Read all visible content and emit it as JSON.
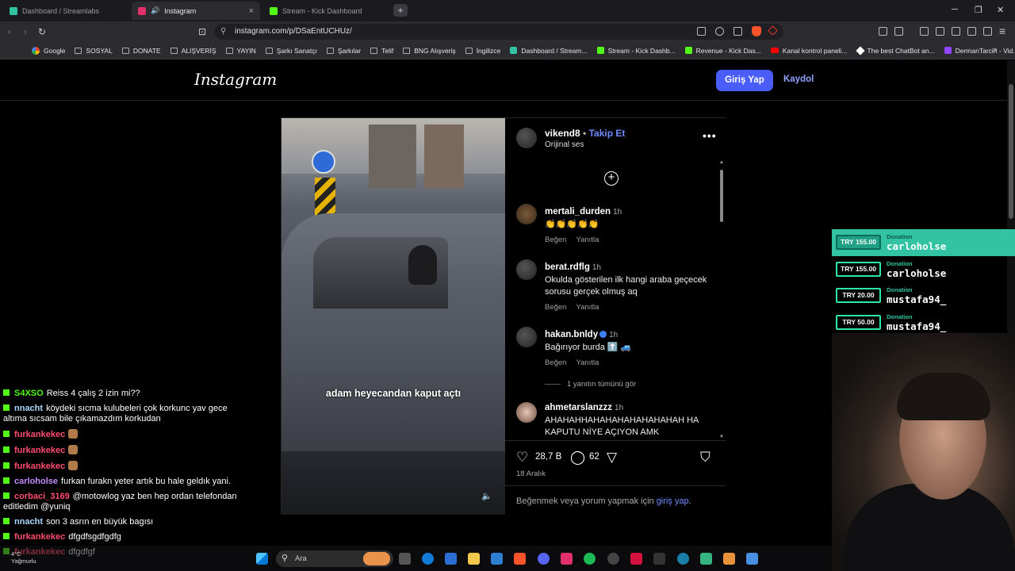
{
  "browser": {
    "tabs": [
      {
        "title": "Dashboard / Streamlabs",
        "color": "#31c3a2"
      },
      {
        "title": "Instagram",
        "color": "#e1306c"
      },
      {
        "title": "Stream - Kick Dashboard",
        "color": "#53fc18"
      }
    ],
    "url": "instagram.com/p/DSaEntUCHUz/",
    "bookmarks": [
      {
        "label": "Google",
        "icon": "google-icon"
      },
      {
        "label": "SOSYAL",
        "icon": "folder-icon"
      },
      {
        "label": "DONATE",
        "icon": "folder-icon"
      },
      {
        "label": "ALIŞVERİŞ",
        "icon": "folder-icon"
      },
      {
        "label": "YAYIN",
        "icon": "folder-icon"
      },
      {
        "label": "Şarkı Sanatçı",
        "icon": "folder-icon"
      },
      {
        "label": "Şarkılar",
        "icon": "folder-icon"
      },
      {
        "label": "Telif",
        "icon": "folder-icon"
      },
      {
        "label": "BNG Alışveriş",
        "icon": "folder-icon"
      },
      {
        "label": "İngilizce",
        "icon": "folder-icon"
      },
      {
        "label": "Dashboard / Stream...",
        "icon": "streamlabs-icon"
      },
      {
        "label": "Stream - Kick Dashb...",
        "icon": "kick-icon"
      },
      {
        "label": "Revenue - Kick Das...",
        "icon": "kick-icon"
      },
      {
        "label": "Kanal kontrol paneli...",
        "icon": "youtube-icon"
      },
      {
        "label": "The best ChatBot an...",
        "icon": "chatbot-icon"
      },
      {
        "label": "DermanTarcin - Vid...",
        "icon": "twitch-icon"
      }
    ]
  },
  "instagram": {
    "logo": "Instagram",
    "login_label": "Giriş Yap",
    "signup_label": "Kaydol",
    "post": {
      "author": "vikend8",
      "follow_label": "Takip Et",
      "audio": "Orijinal ses",
      "video_caption": "adam heyecandan kaput açtı",
      "comments": [
        {
          "user": "mertali_durden",
          "time": "1h",
          "text": "👏👏👏👏👏",
          "like": "Beğen",
          "reply": "Yanıtla"
        },
        {
          "user": "berat.rdflg",
          "time": "1h",
          "text": "Okulda gösterilen ilk hangi araba geçecek sorusu gerçek olmuş aq",
          "like": "Beğen",
          "reply": "Yanıtla"
        },
        {
          "user": "hakan.bnldy",
          "time": "1h",
          "text": "Bağırıyor burda ⬆️ 🚙",
          "like": "Beğen",
          "reply": "Yanıtla"
        },
        {
          "user": "ahmetarslanzzz",
          "time": "1h",
          "text": "AHAHAHHAHAHAHAHAHAHAHAH HA KAPUTU NİYE AÇIYON AMK"
        }
      ],
      "view_replies": "1 yanıtın tümünü gör",
      "likes": "28,7 B",
      "comments_count": "62",
      "date": "18 Aralık",
      "login_prompt_prefix": "Beğenmek veya yorum yapmak için ",
      "login_prompt_link": "giriş yap",
      "login_prompt_suffix": "."
    }
  },
  "chat": [
    {
      "user": "S4XSO",
      "color": "#53fc18",
      "text": "Reiss 4 çalış 2 izin mi??"
    },
    {
      "user": "nnacht",
      "color": "#a8d8ff",
      "text": "köydeki sıcma kulubeleri çok korkunc yav gece altıma sıcsam bile çıkamazdım korkudan"
    },
    {
      "user": "furkankekec",
      "color": "#ff4d6d",
      "text": ""
    },
    {
      "user": "furkankekec",
      "color": "#ff4d6d",
      "text": ""
    },
    {
      "user": "furkankekec",
      "color": "#ff4d6d",
      "text": ""
    },
    {
      "user": "carloholse",
      "color": "#c58cff",
      "text": "furkan furakn yeter artık bu hale geldık yani."
    },
    {
      "user": "corbaci_3169",
      "color": "#ff4d6d",
      "text": "@motowlog yaz ben hep ordan telefondan editledim @yuniq"
    },
    {
      "user": "nnacht",
      "color": "#a8d8ff",
      "text": "son 3 asrın en büyük bagısı"
    },
    {
      "user": "furkankekec",
      "color": "#ff4d6d",
      "text": "dfgdfsgdfgdfg"
    },
    {
      "user": "furkankekec",
      "color": "#ff4d6d",
      "text": "dfgdfgf"
    }
  ],
  "donations": [
    {
      "amount": "TRY 155.00",
      "label": "Donation",
      "name": "carloholse"
    },
    {
      "amount": "TRY 155.00",
      "label": "Donation",
      "name": "carloholse"
    },
    {
      "amount": "TRY 20.00",
      "label": "Donation",
      "name": "mustafa94_"
    },
    {
      "amount": "TRY 50.00",
      "label": "Donation",
      "name": "mustafa94_"
    }
  ],
  "taskbar": {
    "search_placeholder": "Ara",
    "weather_temp": "4°C",
    "weather_text": "Yağmurlu"
  }
}
